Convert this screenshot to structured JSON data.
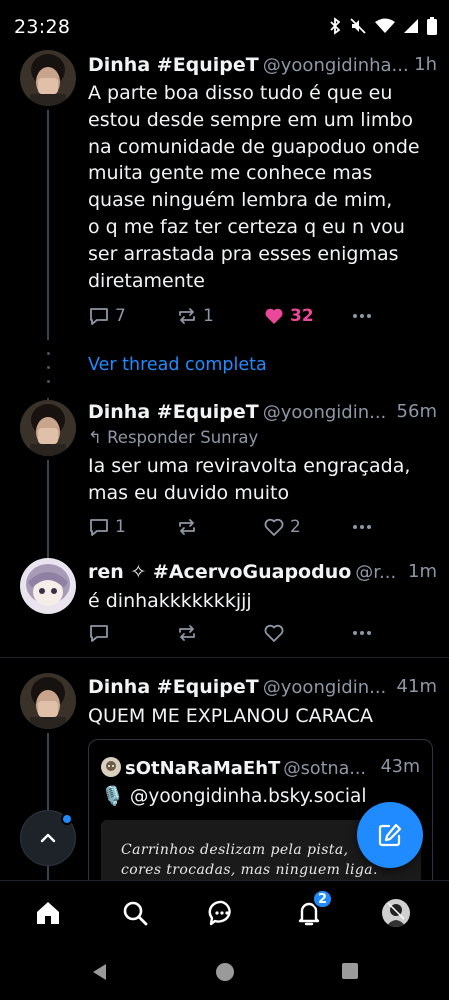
{
  "status_bar": {
    "time": "23:28"
  },
  "posts": [
    {
      "author": "Dinha #EquipeT",
      "handle": "@yoongidinha....",
      "time": "1h",
      "lines": [
        "A parte boa disso tudo é que eu",
        "estou desde sempre em um limbo",
        "na comunidade de guapoduo onde",
        "muita gente me conhece mas",
        "quase ninguém lembra de mim,",
        "o q me faz ter certeza q eu n vou",
        "ser arrastada pra esses enigmas",
        "diretamente"
      ],
      "replies": "7",
      "reposts": "1",
      "likes": "32"
    },
    {
      "author": "Dinha #EquipeT",
      "handle": "@yoongidin...",
      "time": "56m",
      "reply_to": "Responder Sunray",
      "lines": [
        "Ia ser uma reviravolta engraçada,",
        "mas eu duvido muito"
      ],
      "replies": "1",
      "reposts": "",
      "likes": "2"
    },
    {
      "author": "ren ✧ #AcervoGuapoduo",
      "handle": "@r...",
      "time": "1m",
      "lines": [
        "é dinhakkkkkkkjjj"
      ],
      "replies": "",
      "reposts": "",
      "likes": ""
    },
    {
      "author": "Dinha #EquipeT",
      "handle": "@yoongidin...",
      "time": "41m",
      "lines": [
        "QUEM ME EXPLANOU CARACA"
      ]
    }
  ],
  "view_thread": "Ver thread completa",
  "quote": {
    "author": "sOtNaRaMaEhT",
    "handle": "@sotna...",
    "time": "43m",
    "text": "🎙️ @yoongidinha.bsky.social",
    "image_text": "Carrinhos deslizam pela pista,\ncores trocadas, mas ninguem liga."
  },
  "bottom_nav": {
    "notifications_count": "2"
  },
  "colors": {
    "accent": "#208bfe",
    "like": "#ec4899",
    "muted": "#8d97a5",
    "background": "#000000"
  }
}
